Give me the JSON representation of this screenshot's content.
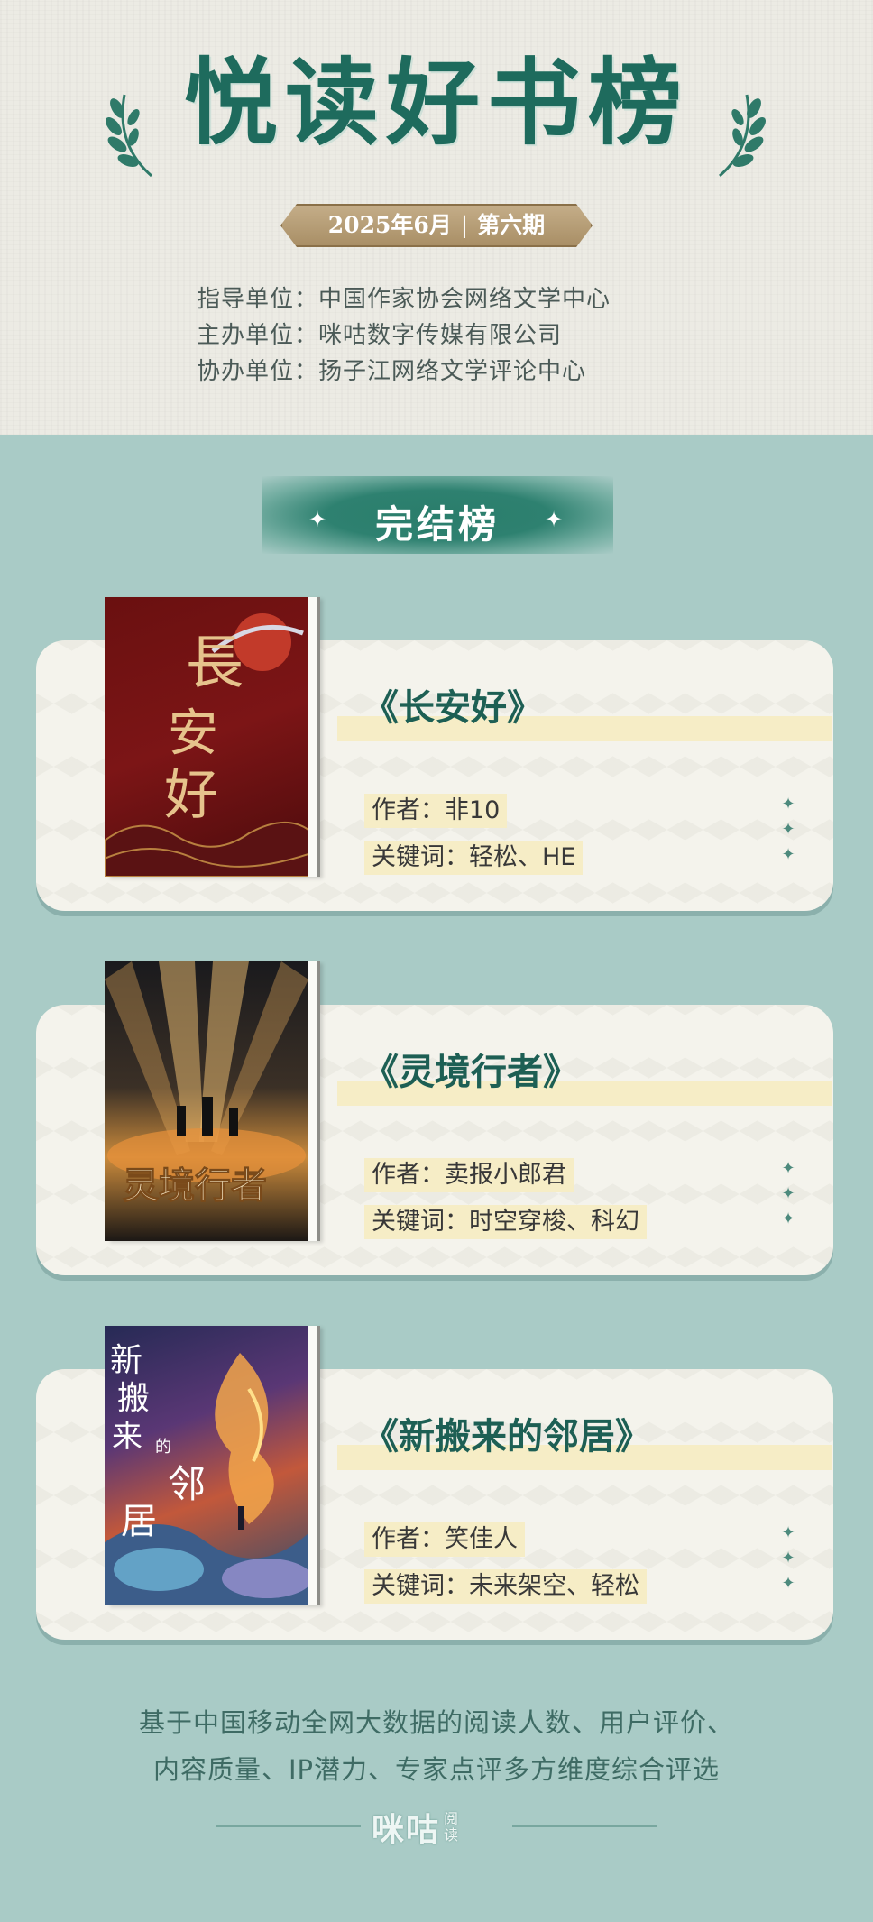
{
  "header": {
    "title": "悦读好书榜",
    "issue": {
      "date": "2025年6月",
      "separator": "|",
      "period": "第六期"
    },
    "org_lines": [
      "指导单位：中国作家协会网络文学中心",
      "主办单位：咪咕数字传媒有限公司",
      "协办单位：扬子江网络文学评论中心"
    ]
  },
  "section": {
    "title": "完结榜",
    "sparkle_icon": "✦"
  },
  "books": [
    {
      "title": "《长安好》",
      "author": "作者：非10",
      "keywords": "关键词：轻松、HE",
      "cover_text": "長安好"
    },
    {
      "title": "《灵境行者》",
      "author": "作者：卖报小郎君",
      "keywords": "关键词：时空穿梭、科幻",
      "cover_text": "灵境行者"
    },
    {
      "title": "《新搬来的邻居》",
      "author": "作者：笑佳人",
      "keywords": "关键词：未来架空、轻松",
      "cover_text": "新搬来的邻居"
    }
  ],
  "footer": {
    "lines": [
      "基于中国移动全网大数据的阅读人数、用户评价、",
      "内容质量、IP潜力、专家点评多方维度综合评选"
    ],
    "brand": "咪咕",
    "brand_sub": "阅读"
  },
  "colors": {
    "accent": "#1e6b5d",
    "background": "#a9cbc6",
    "highlight": "#f6edc6",
    "gold": "#b59c74"
  }
}
